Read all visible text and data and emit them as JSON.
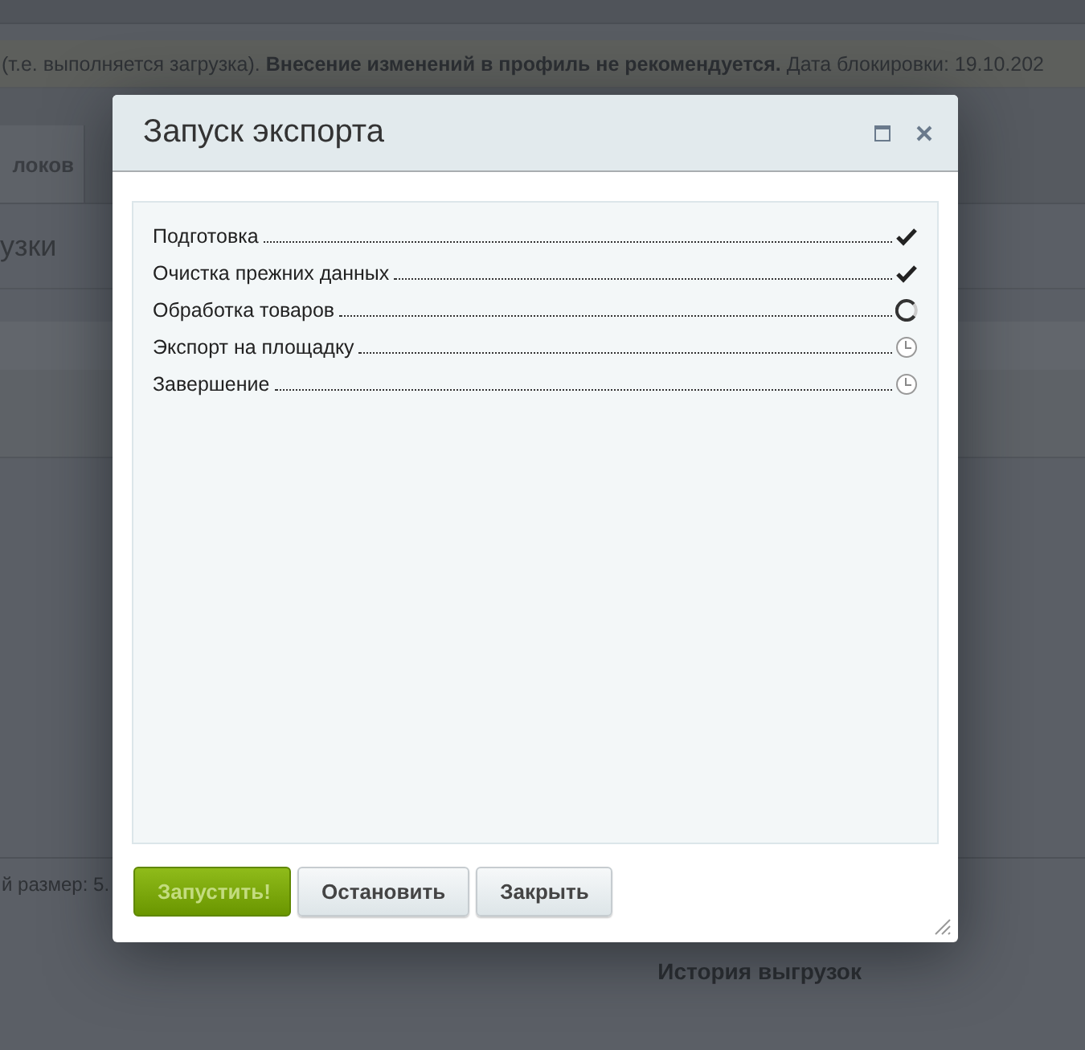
{
  "background_page": {
    "notice": "(т.е. выполняется загрузка). **Внесение изменений в профиль не рекомендуется.** Дата блокировки: 19.10.202",
    "tab": "локов",
    "heading": "узки",
    "size_label": "й размер: 5.",
    "history_title": "История выгрузок"
  },
  "dialog": {
    "title": "Запуск экспорта",
    "steps": [
      {
        "label": "Подготовка",
        "kind": "done"
      },
      {
        "label": "Очистка прежних данных",
        "kind": "done"
      },
      {
        "label": "Обработка товаров",
        "kind": "running"
      },
      {
        "label": "Экспорт на площадку",
        "kind": "pending"
      },
      {
        "label": "Завершение",
        "kind": "pending"
      }
    ],
    "buttons": [
      {
        "label": "Запустить!",
        "kind": "primary",
        "disabled": true
      },
      {
        "label": "Остановить",
        "kind": "secondary",
        "disabled": false
      },
      {
        "label": "Закрыть",
        "kind": "secondary",
        "disabled": false
      }
    ]
  }
}
